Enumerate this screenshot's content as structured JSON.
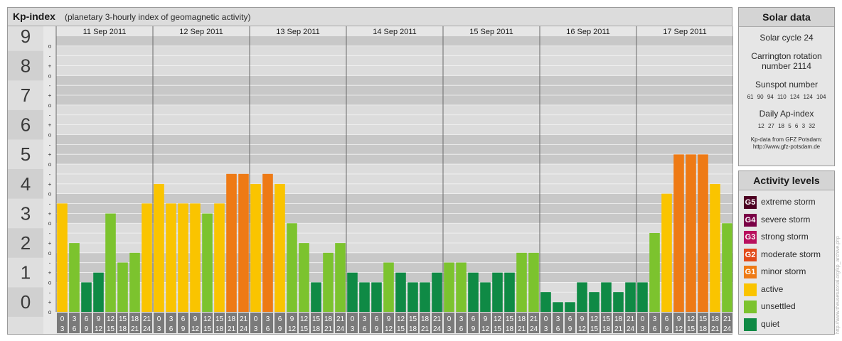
{
  "header": {
    "title": "Kp-index",
    "subtitle": "(planetary 3-hourly index of geomagnetic activity)"
  },
  "solar": {
    "heading": "Solar data",
    "cycle": "Solar cycle 24",
    "carrington_line1": "Carrington rotation",
    "carrington_line2": "number 2114",
    "sunspot_heading": "Sunspot number",
    "sunspot_values": "61 90 94 110 124 124 104",
    "ap_heading": "Daily Ap-index",
    "ap_values": "12 27 18 5 6 3 32",
    "source_line1": "Kp-data from GFZ Potsdam:",
    "source_line2": "http://www.gfz-potsdam.de"
  },
  "activity": {
    "heading": "Activity levels",
    "levels": [
      {
        "code": "G5",
        "label": "extreme storm",
        "color": "#4d0022"
      },
      {
        "code": "G4",
        "label": "severe storm",
        "color": "#7a0046"
      },
      {
        "code": "G3",
        "label": "strong storm",
        "color": "#b8105e"
      },
      {
        "code": "G2",
        "label": "moderate storm",
        "color": "#e24b1b"
      },
      {
        "code": "G1",
        "label": "minor storm",
        "color": "#ee7a15"
      },
      {
        "code": "",
        "label": "active",
        "color": "#fac400"
      },
      {
        "code": "",
        "label": "unsettled",
        "color": "#7cc32e"
      },
      {
        "code": "",
        "label": "quiet",
        "color": "#0f8a45"
      }
    ]
  },
  "credit": "http://www.theusetutorial.org/kp_archive.php",
  "chart_data": {
    "type": "bar",
    "days": [
      "11 Sep 2011",
      "12 Sep 2011",
      "13 Sep 2011",
      "14 Sep 2011",
      "15 Sep 2011",
      "16 Sep 2011",
      "17 Sep 2011"
    ],
    "interval_start": [
      "0",
      "3",
      "6",
      "9",
      "12",
      "15",
      "18",
      "21"
    ],
    "interval_end": [
      "3",
      "6",
      "9",
      "12",
      "15",
      "18",
      "21",
      "24"
    ],
    "y_ticks": [
      "0",
      "1",
      "2",
      "3",
      "4",
      "5",
      "6",
      "7",
      "8",
      "9"
    ],
    "sub_ticks": [
      "-",
      "o",
      "+"
    ],
    "ylim": [
      0,
      9.33
    ],
    "values": [
      3.67,
      2.33,
      1.0,
      1.33,
      3.33,
      1.67,
      2.0,
      3.67,
      4.33,
      3.67,
      3.67,
      3.67,
      3.33,
      3.67,
      4.67,
      4.67,
      4.33,
      4.67,
      4.33,
      3.0,
      2.33,
      1.0,
      2.0,
      2.33,
      1.33,
      1.0,
      1.0,
      1.67,
      1.33,
      1.0,
      1.0,
      1.33,
      1.67,
      1.67,
      1.33,
      1.0,
      1.33,
      1.33,
      2.0,
      2.0,
      0.67,
      0.33,
      0.33,
      1.0,
      0.67,
      1.0,
      0.67,
      1.0,
      1.0,
      2.67,
      4.0,
      5.33,
      5.33,
      5.33,
      4.33,
      3.0
    ],
    "colors": {
      "quiet": "#0f8a45",
      "unsettled": "#7cc32e",
      "active": "#fac400",
      "minor_storm": "#ee7a15",
      "moderate_storm": "#e24b1b"
    },
    "grid": true
  }
}
